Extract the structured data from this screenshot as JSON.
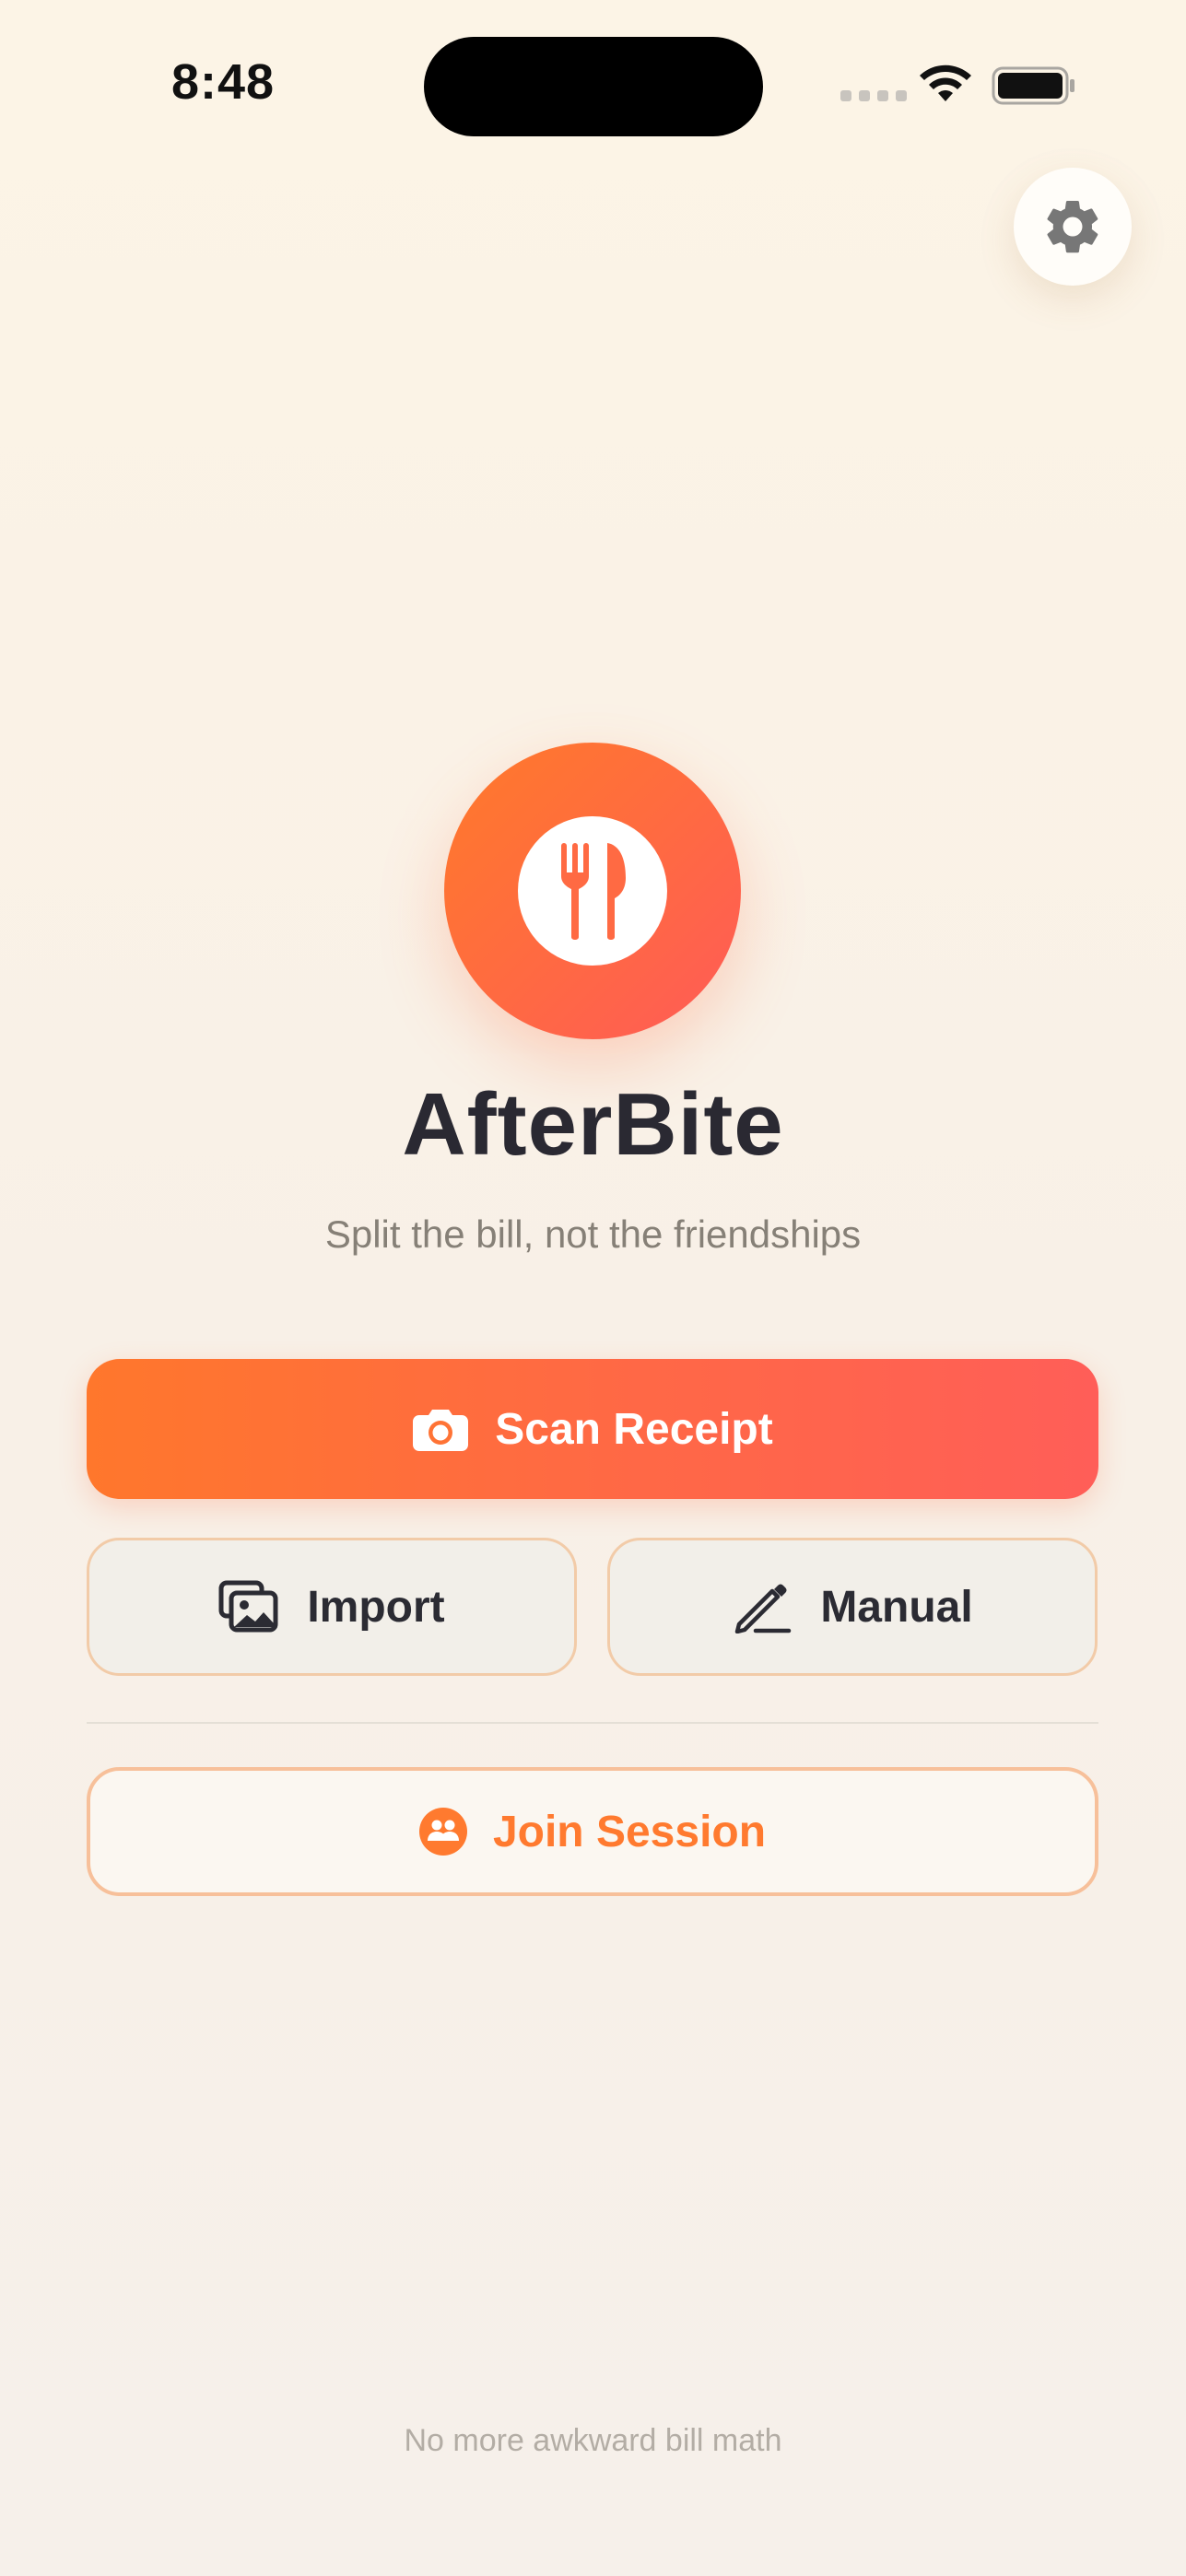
{
  "status_bar": {
    "time": "8:48"
  },
  "colors": {
    "accent": "#FF7A2F",
    "accent_end": "#FF5E58",
    "background": "#FBF3E8",
    "title": "#2A2932",
    "subtitle": "#868077",
    "footer": "#B3ADA5"
  },
  "header": {
    "settings_icon": "gear-icon"
  },
  "hero": {
    "logo_icon": "fork-knife-icon",
    "title": "AfterBite",
    "subtitle": "Split the bill, not the friendships"
  },
  "actions": {
    "scan": {
      "label": "Scan Receipt",
      "icon": "camera-icon"
    },
    "import": {
      "label": "Import",
      "icon": "photos-icon"
    },
    "manual": {
      "label": "Manual",
      "icon": "pencil-icon"
    },
    "join": {
      "label": "Join Session",
      "icon": "people-icon"
    }
  },
  "footer": {
    "note": "No more awkward bill math"
  }
}
